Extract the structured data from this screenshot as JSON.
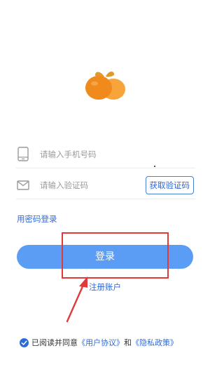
{
  "phone": {
    "placeholder": "请输入手机号码"
  },
  "code": {
    "placeholder": "请输入验证码",
    "button_label": "获取验证码"
  },
  "password_login_label": "用密码登录",
  "login_button_label": "登录",
  "register_label": "注册账户",
  "agreement": {
    "prefix": "已阅读并同意",
    "user_agreement": "《用户协议》",
    "and": "和",
    "privacy_policy": "《隐私政策》",
    "checked": true
  },
  "colors": {
    "primary": "#5b9cf5",
    "link": "#2f6bd8",
    "annotation": "#e23a3a",
    "logo_orange": "#f08a1c",
    "logo_leaf": "#e0992d"
  },
  "icons": {
    "logo": "orange-fruit-logo",
    "phone": "phone-icon",
    "code": "mail-icon",
    "check": "check-circle-icon"
  }
}
